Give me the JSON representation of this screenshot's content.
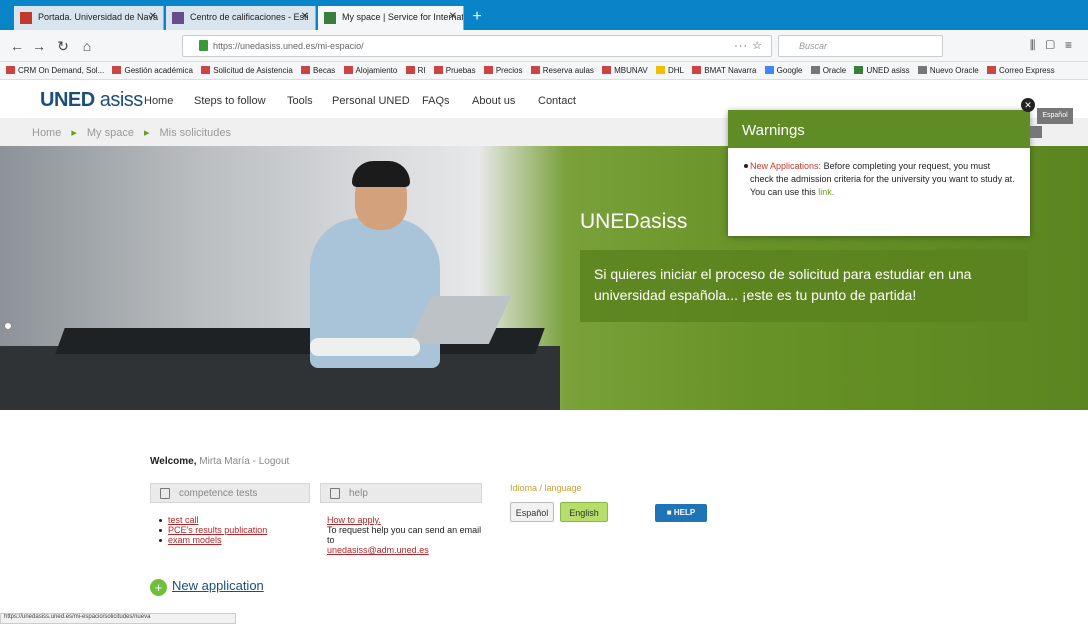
{
  "browser": {
    "tabs": [
      {
        "title": "Portada. Universidad de Nava",
        "color": "#c0392b"
      },
      {
        "title": "Centro de calificaciones - Esti",
        "color": "#6b4c8a"
      },
      {
        "title": "My space | Service for Internat",
        "color": "#3b7d3b"
      }
    ],
    "url": "https://unedasiss.uned.es/mi-espacio/",
    "search_placeholder": "Buscar",
    "bookmarks": [
      "CRM On Demand, Sol...",
      "Gestión académica",
      "Solicitud de Asistencia",
      "Becas",
      "Alojamiento",
      "RI",
      "Pruebas",
      "Precios",
      "Reserva aulas",
      "MBUNAV",
      "DHL",
      "BMAT Navarra",
      "Google",
      "Oracle",
      "UNED asiss",
      "Nuevo Oracle",
      "Correo Express"
    ]
  },
  "site": {
    "logo_bold": "UNED",
    "logo_light": "asiss",
    "menu": [
      "Home",
      "Steps to follow",
      "Tools",
      "Personal UNED",
      "FAQs",
      "About us",
      "Contact"
    ],
    "breadcrumb": [
      "Home",
      "My space",
      "Mis solicitudes"
    ]
  },
  "hero": {
    "title": "UNEDasiss",
    "text": "Si quieres iniciar el proceso de solicitud para estudiar en una universidad española... ¡este es tu punto de partida!"
  },
  "warnings": {
    "title": "Warnings",
    "highlight": "New Applications:",
    "text": "Before completing your request, you must check the admission criteria for the university you want to study at. You can use this",
    "link": "link."
  },
  "lang_tag": "Español",
  "welcome": {
    "label": "Welcome,",
    "name": "Mirta María",
    "logout": "- Logout"
  },
  "competence": {
    "title": "competence tests",
    "links": [
      "test call",
      "PCE's results publication",
      "exam models"
    ]
  },
  "help_panel": {
    "title": "help",
    "link": "How to apply.",
    "text": "To request help you can send an email to",
    "email": "unedasiss@adm.uned.es"
  },
  "language": {
    "label": "Idioma / language",
    "options": [
      "Español",
      "English"
    ],
    "selected": "English"
  },
  "help_button": "HELP",
  "new_application": "New application",
  "status_bar": "https://unedasiss.uned.es/mi-espacio/solicitudes/nueva"
}
